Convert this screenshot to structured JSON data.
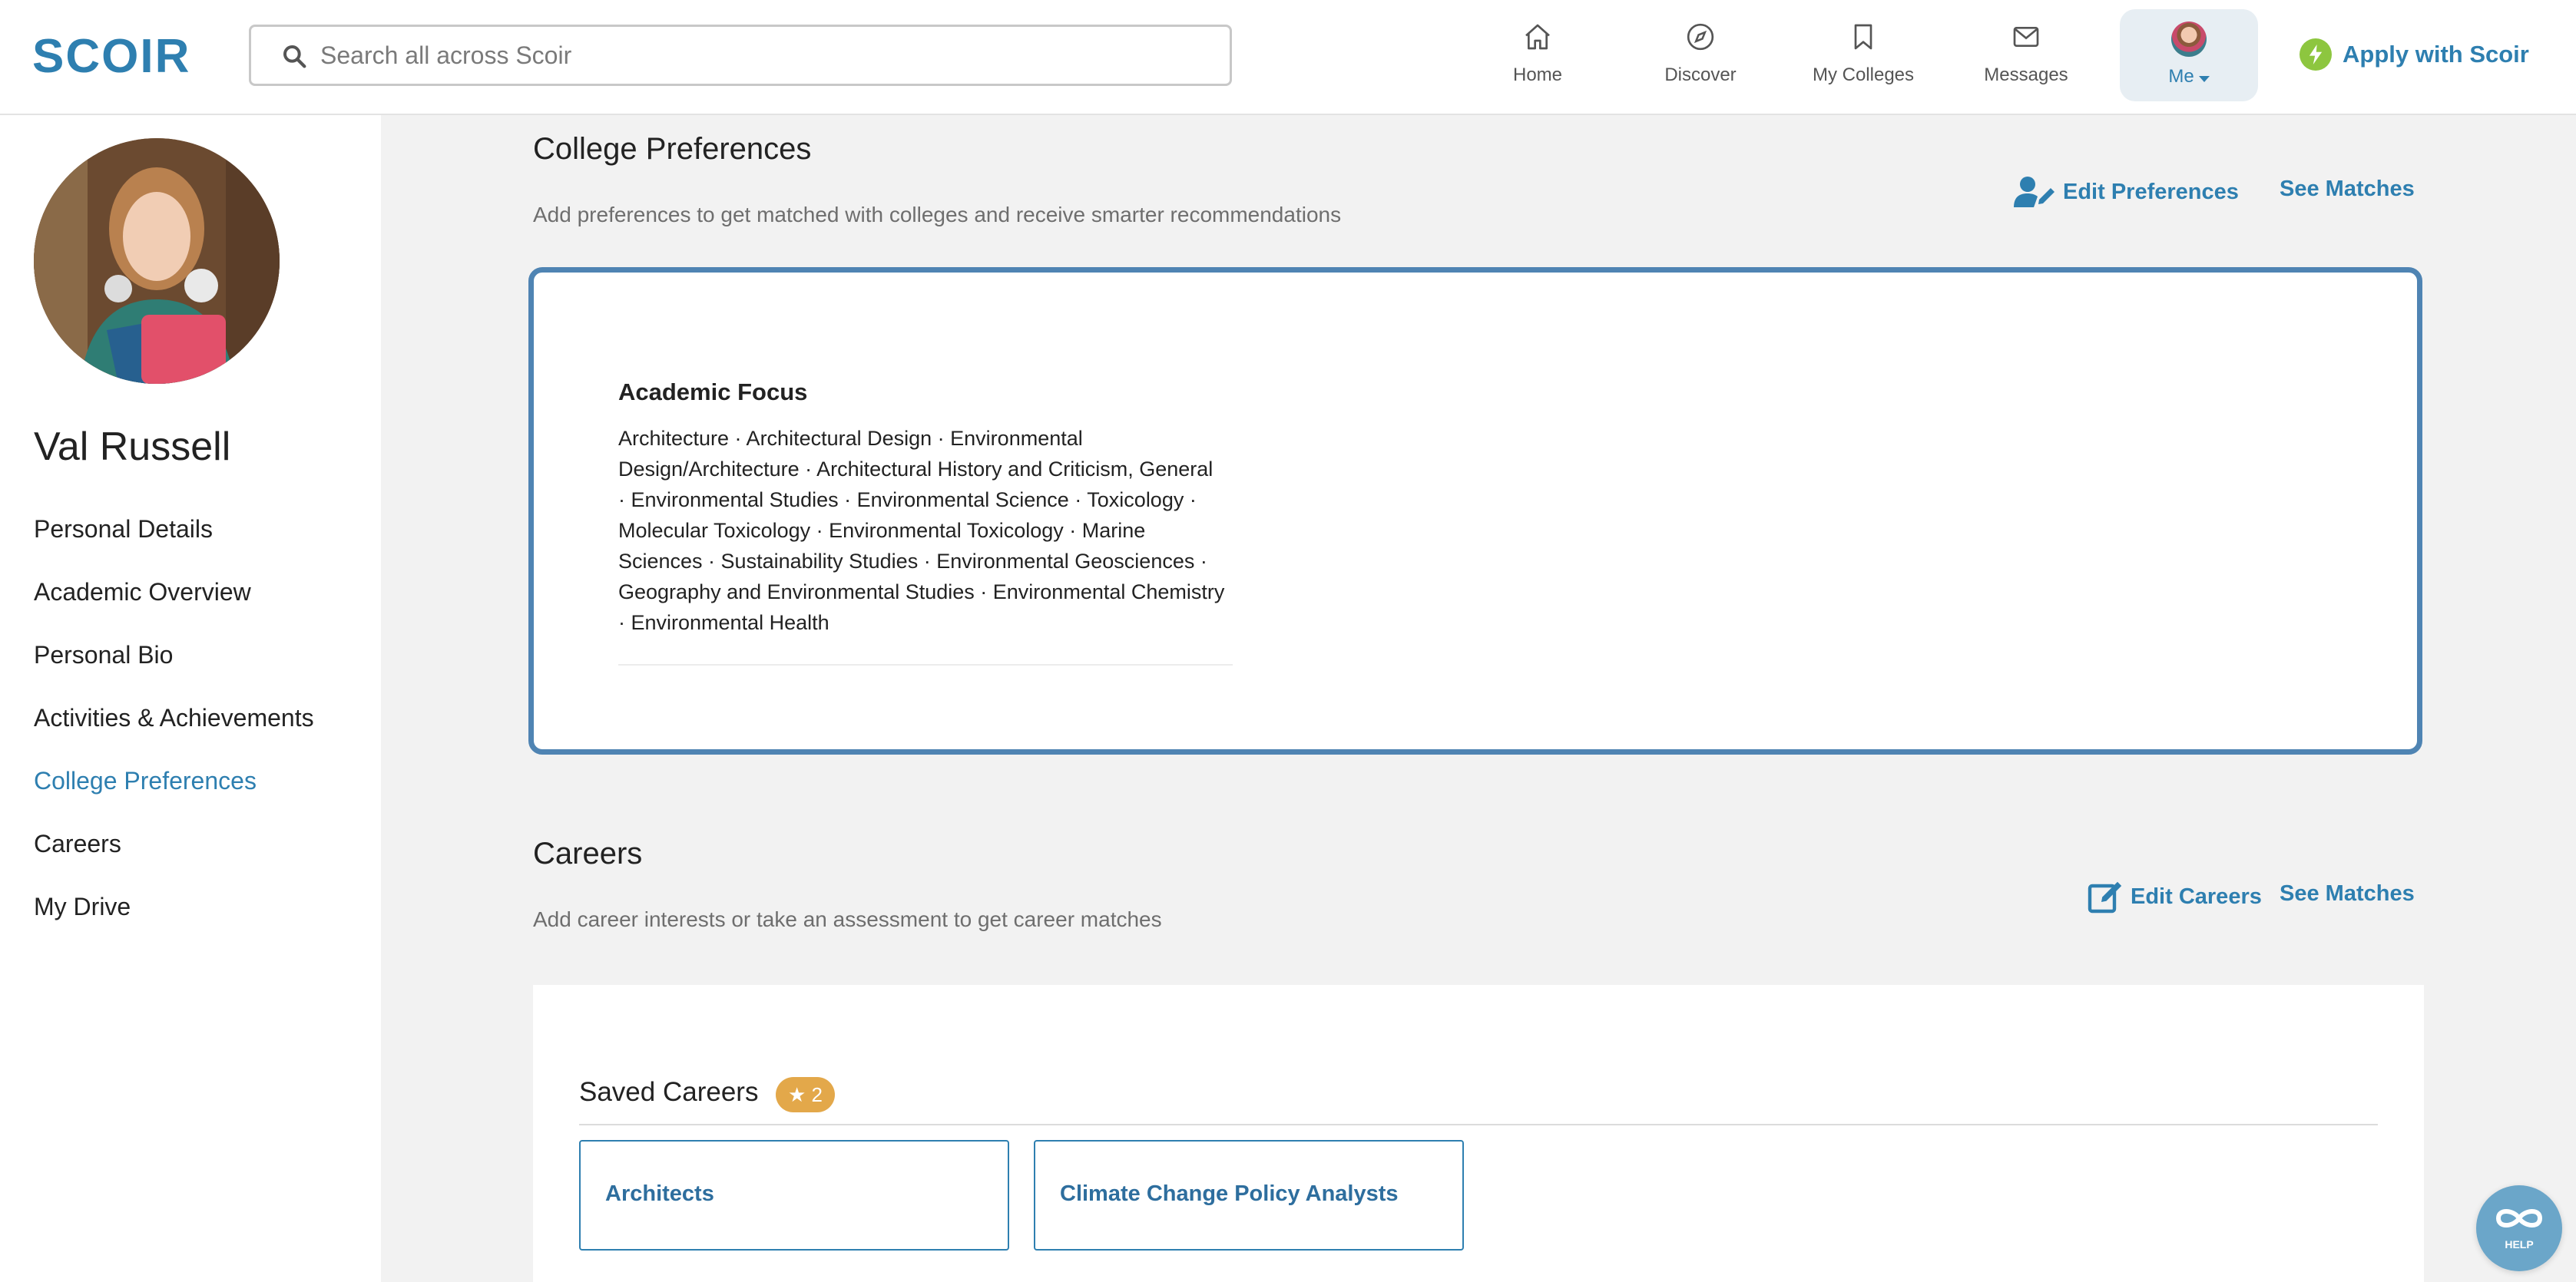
{
  "header": {
    "logo": "SCOIR",
    "search_placeholder": "Search all across Scoir",
    "nav": [
      {
        "label": "Home",
        "icon": "home-icon"
      },
      {
        "label": "Discover",
        "icon": "compass-icon"
      },
      {
        "label": "My Colleges",
        "icon": "bookmark-icon"
      },
      {
        "label": "Messages",
        "icon": "mail-icon"
      }
    ],
    "me_label": "Me",
    "apply_label": "Apply with Scoir"
  },
  "sidebar": {
    "name": "Val Russell",
    "items": [
      {
        "label": "Personal Details",
        "active": false
      },
      {
        "label": "Academic Overview",
        "active": false
      },
      {
        "label": "Personal Bio",
        "active": false
      },
      {
        "label": "Activities & Achievements",
        "active": false
      },
      {
        "label": "College Preferences",
        "active": true
      },
      {
        "label": "Careers",
        "active": false
      },
      {
        "label": "My Drive",
        "active": false
      }
    ]
  },
  "college_preferences": {
    "title": "College Preferences",
    "subtitle": "Add preferences to get matched with colleges and receive smarter recommendations",
    "edit_label": "Edit Preferences",
    "matches_label": "See Matches",
    "academic_focus": {
      "title": "Academic Focus",
      "text": "Architecture · Architectural Design · Environmental Design/Architecture · Architectural History and Criticism, General · Environmental Studies · Environmental Science · Toxicology · Molecular Toxicology · Environmental Toxicology · Marine Sciences · Sustainability Studies · Environmental Geosciences · Geography and Environmental Studies · Environmental Chemistry · Environmental Health"
    }
  },
  "careers": {
    "title": "Careers",
    "subtitle": "Add career interests or take an assessment to get career matches",
    "edit_label": "Edit Careers",
    "matches_label": "See Matches",
    "saved_title": "Saved Careers",
    "saved_count": "★ 2",
    "items": [
      "Architects",
      "Climate Change Policy Analysts"
    ]
  },
  "help_label": "HELP",
  "colors": {
    "accent": "#2e7fb0",
    "card_border": "#4f84b3",
    "badge": "#e3a84a",
    "apply_bolt": "#8dc63f"
  }
}
